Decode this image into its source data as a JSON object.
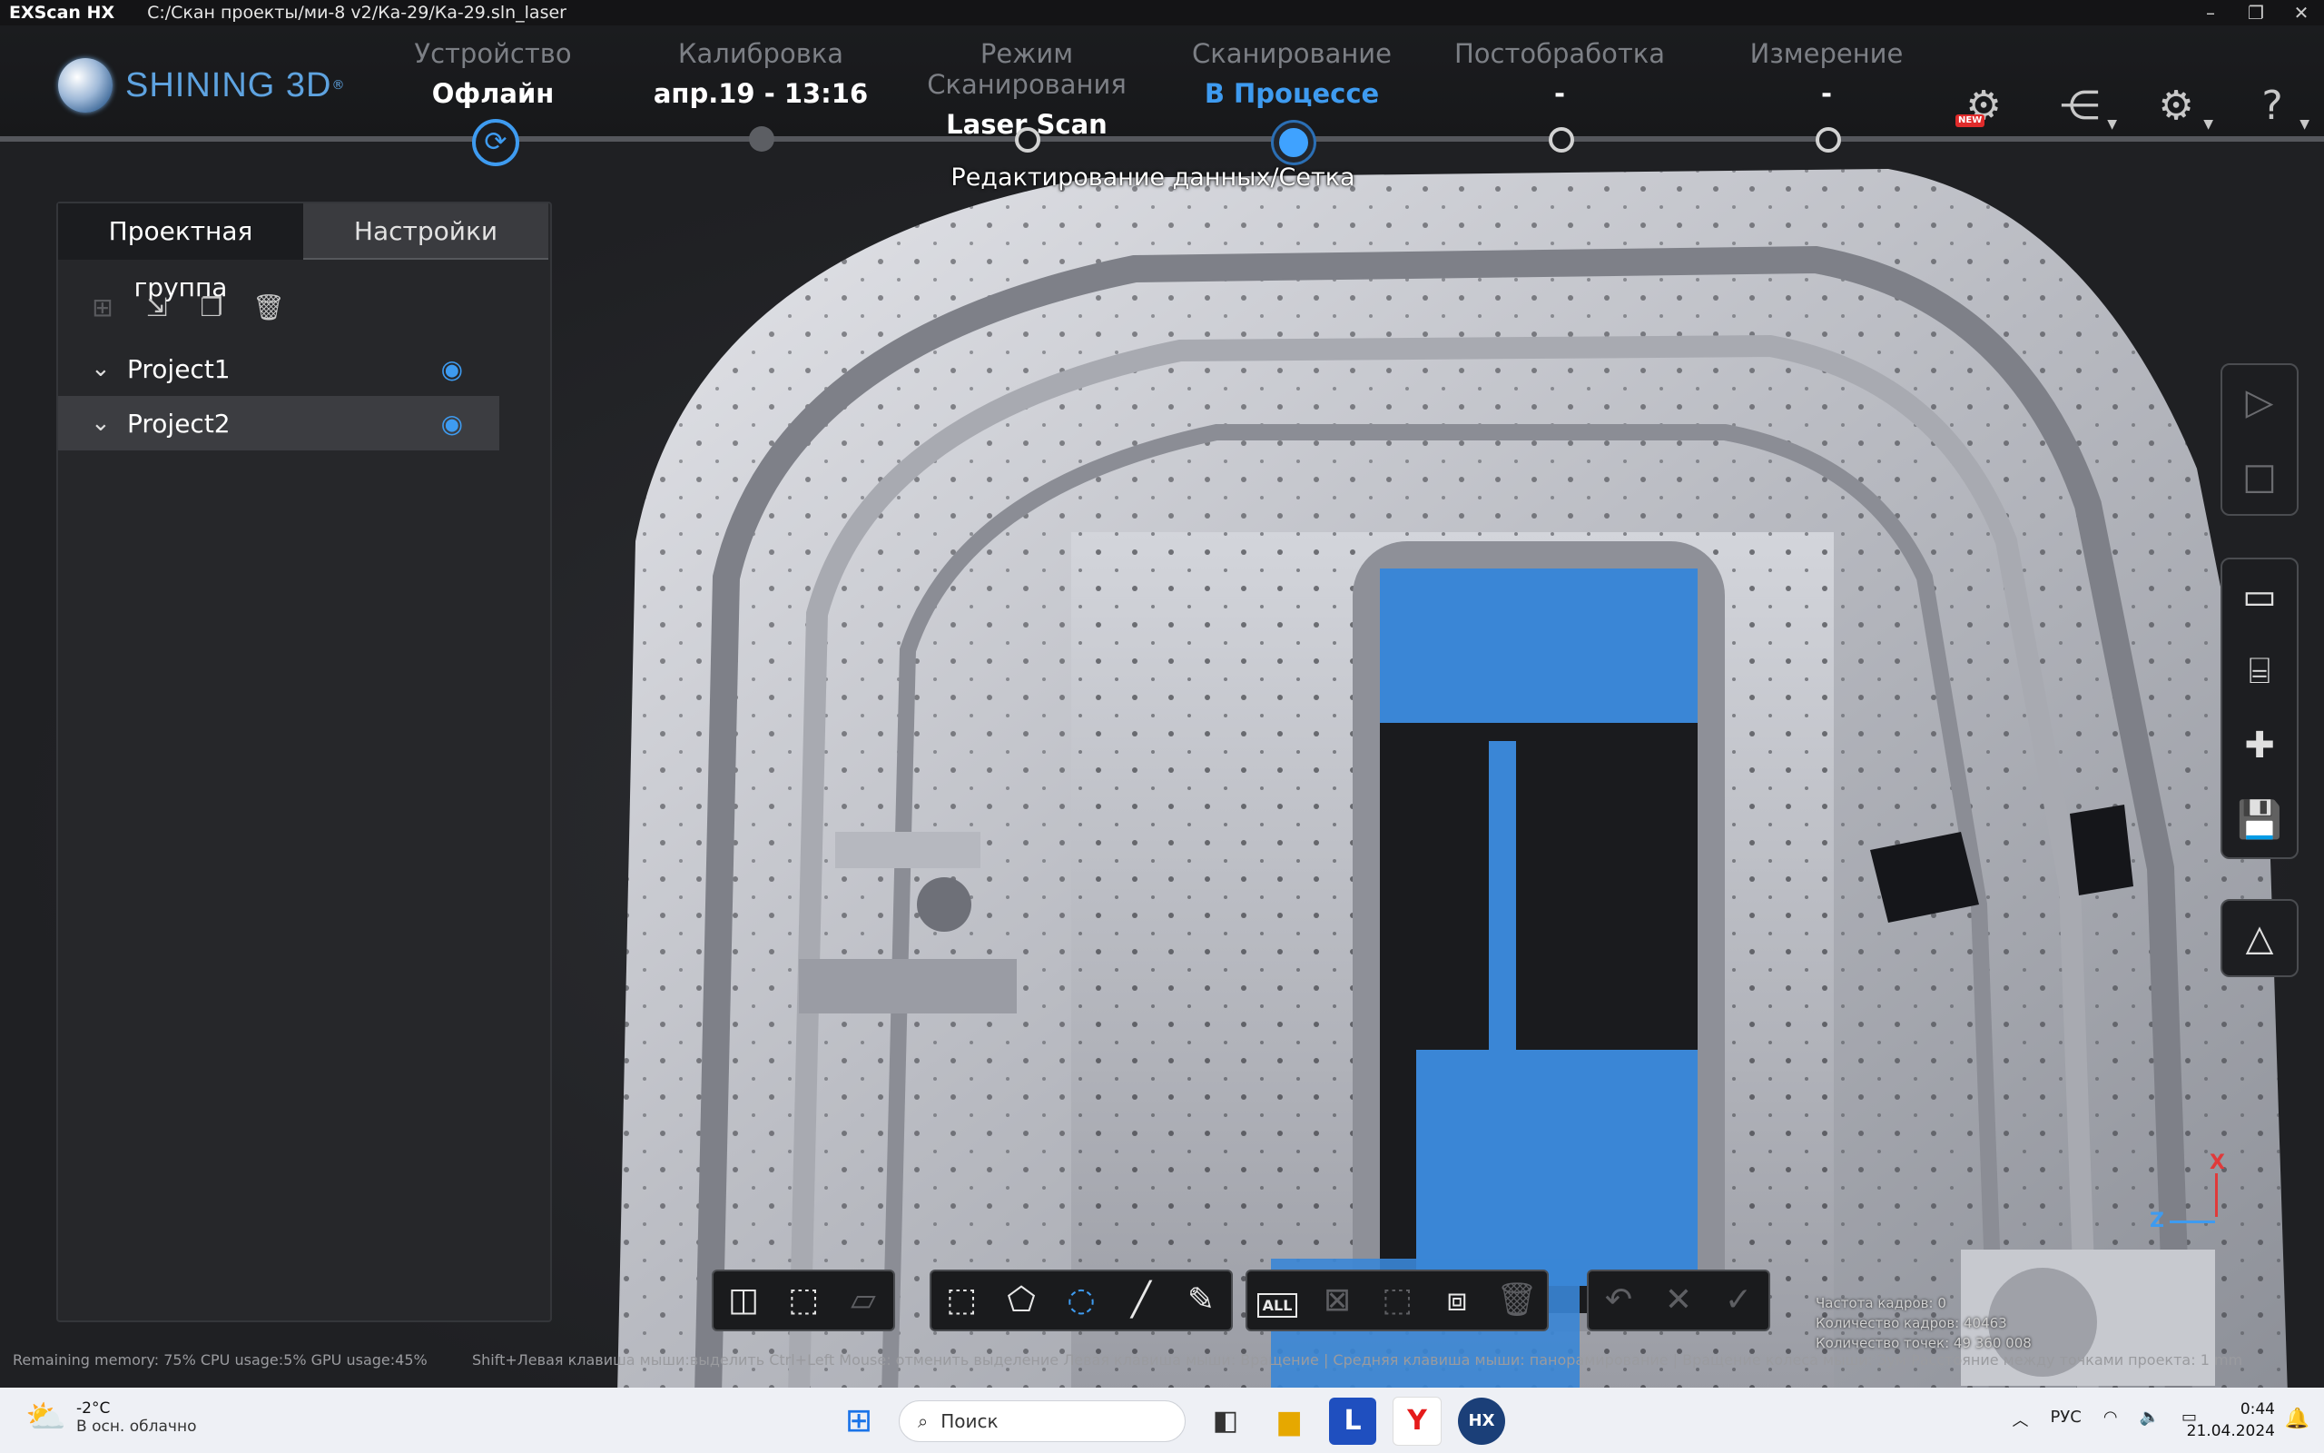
{
  "titlebar": {
    "app_name": "EXScan HX",
    "project_path": "C:/Скан проекты/ми-8 v2/Ка-29/Ка-29.sln_laser",
    "minimize": "–",
    "restore": "❐",
    "close": "✕"
  },
  "logo": {
    "text": "SHINING 3D",
    "reg": "®"
  },
  "steps": [
    {
      "label": "Устройство",
      "value": "Офлайн"
    },
    {
      "label": "Калибровка",
      "value": "апр.19 - 13:16"
    },
    {
      "label": "Режим Сканирования",
      "value": "Laser Scan"
    },
    {
      "label": "Сканирование",
      "value": "В Процессе"
    },
    {
      "label": "Постобработка",
      "value": "-"
    },
    {
      "label": "Измерение",
      "value": "-"
    }
  ],
  "substep_label": "Редактирование данных/Сетка",
  "header_icons": {
    "new_badge": "NEW"
  },
  "panel": {
    "tabs": [
      "Проектная группа",
      "Настройки"
    ],
    "projects": [
      {
        "name": "Project1"
      },
      {
        "name": "Project2"
      }
    ]
  },
  "status_bar": {
    "resources": "Remaining memory: 75% CPU usage:5%  GPU usage:45%",
    "hint": "Shift+Левая клавиша мыши:выделить  Ctrl+Left Mouse: отменить выделение  Левая клавиша мыши: Вращение | Средняя клавиша мыши: панорамирование | Вращение колеса мыши: Зум  Расстояние между точками проекта: 1 mm"
  },
  "stats": {
    "line1": "Частота кадров:  0",
    "line2": "Количество кадров: 40463",
    "line3": "Количество точек: 49 360 008"
  },
  "axis": {
    "x": "X",
    "z": "Z"
  },
  "taskbar": {
    "temperature": "-2°C",
    "weather": "В осн. облачно",
    "search_placeholder": "Поиск",
    "lang": "РУС",
    "time": "0:44",
    "date": "21.04.2024",
    "app_l": "L",
    "app_y": "Y",
    "app_hx": "HX"
  },
  "colors": {
    "accent": "#3e9bf0",
    "scan_mesh": "#c9cbd1",
    "selected_mesh": "#3a86d6"
  }
}
